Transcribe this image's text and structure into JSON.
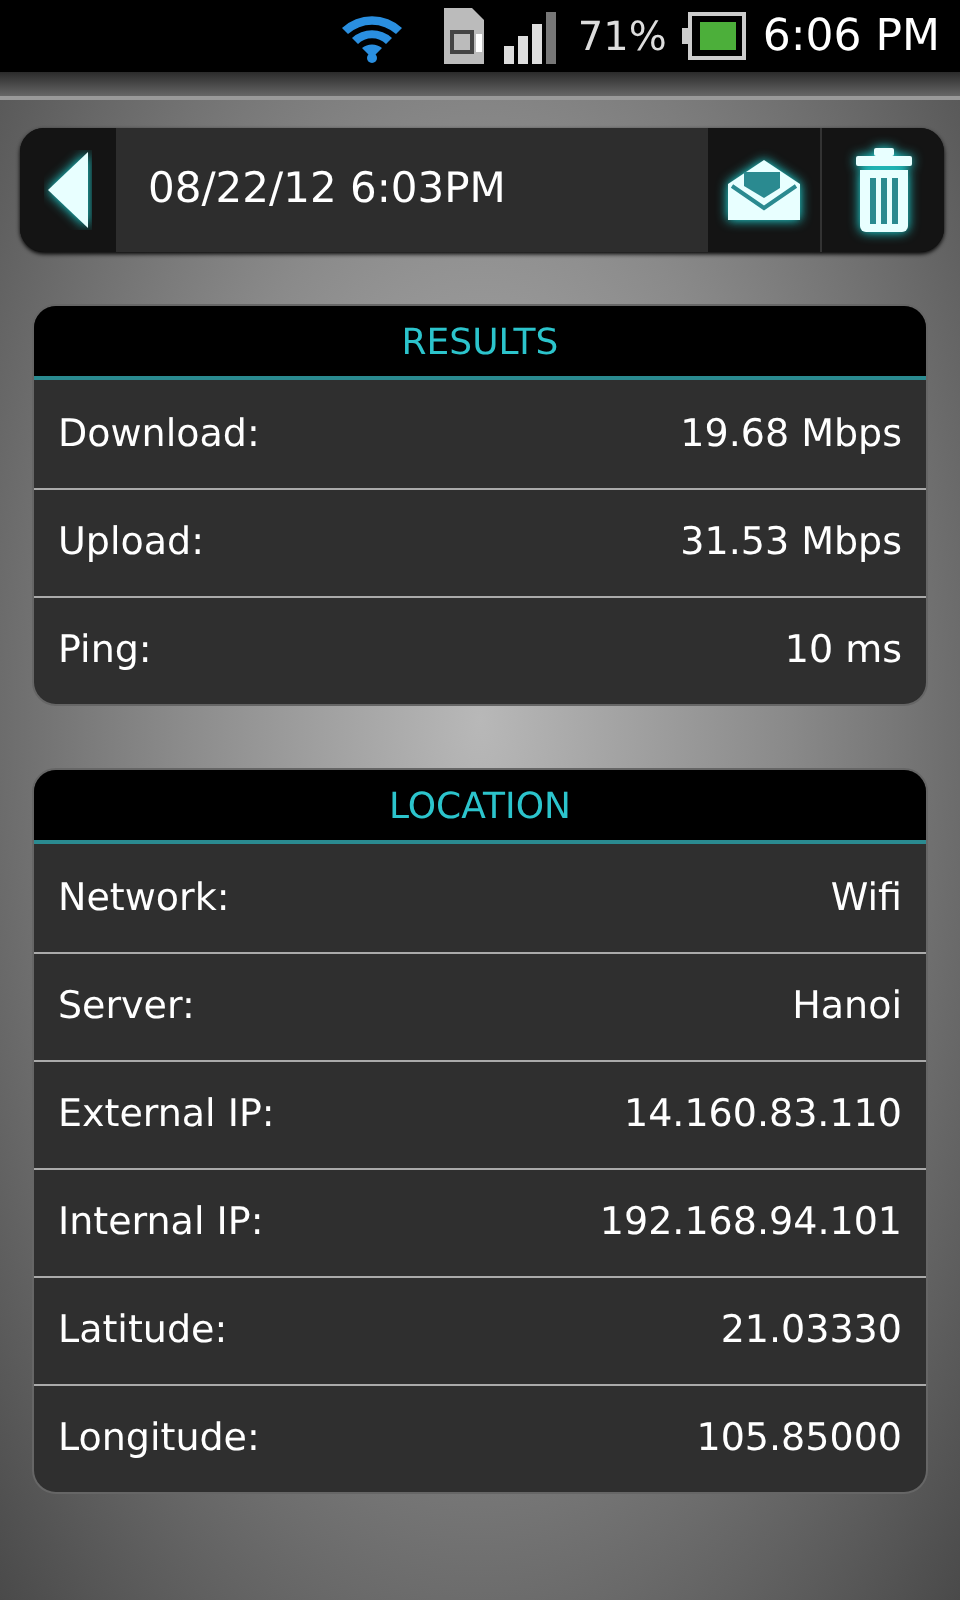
{
  "status_bar": {
    "battery_percent": "71%",
    "time": "6:06 PM"
  },
  "toolbar": {
    "date": "08/22/12 6:03PM"
  },
  "sections": [
    {
      "title": "RESULTS",
      "rows": [
        {
          "label": "Download:",
          "value": "19.68 Mbps"
        },
        {
          "label": "Upload:",
          "value": "31.53 Mbps"
        },
        {
          "label": "Ping:",
          "value": "10 ms"
        }
      ]
    },
    {
      "title": "LOCATION",
      "rows": [
        {
          "label": "Network:",
          "value": "Wifi"
        },
        {
          "label": "Server:",
          "value": "Hanoi"
        },
        {
          "label": "External IP:",
          "value": "14.160.83.110"
        },
        {
          "label": "Internal IP:",
          "value": "192.168.94.101"
        },
        {
          "label": "Latitude:",
          "value": "21.03330"
        },
        {
          "label": "Longitude:",
          "value": "105.85000"
        }
      ]
    }
  ]
}
